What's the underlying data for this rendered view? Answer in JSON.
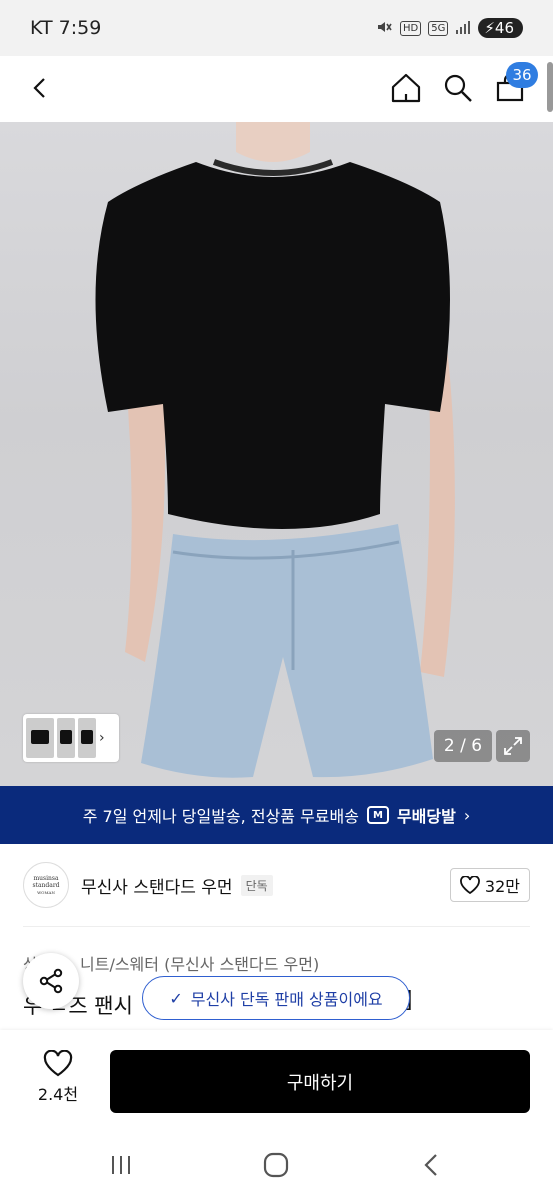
{
  "status_bar": {
    "carrier_time": "KT 7:59",
    "network_hd": "HD",
    "network_5g": "5G",
    "battery": "46",
    "icons": [
      "mute-icon",
      "signal-icon",
      "battery-icon"
    ]
  },
  "header": {
    "cart_count": "36",
    "icons": [
      "back-icon",
      "home-icon",
      "search-icon",
      "cart-icon"
    ]
  },
  "gallery": {
    "counter": "2 / 6",
    "current": 2,
    "total": 6
  },
  "banner": {
    "text": "주 7일 언제나 당일발송, 전상품 무료배송",
    "badge_letter": "M",
    "brand": "무배당발"
  },
  "brand": {
    "logo_line1": "musinsa",
    "logo_line2": "standard",
    "logo_line3": "WOMAN",
    "name": "무신사 스탠다드 우먼",
    "exclusive_tag": "단독",
    "likes": "32만"
  },
  "product": {
    "category_prefix": "상",
    "category": "니트/스웨터 (무신사 스탠다드 우먼)",
    "title_visible": "우 ㄴ즈 팬시",
    "title_end": "]"
  },
  "toast": {
    "text": "무신사 단독 판매 상품이에요"
  },
  "action_bar": {
    "wish_count": "2.4천",
    "buy_label": "구매하기"
  },
  "colors": {
    "banner_bg": "#0a2a7c",
    "badge_blue": "#2f7de1",
    "toast_border": "#2f5fd0",
    "buy_bg": "#000000"
  }
}
